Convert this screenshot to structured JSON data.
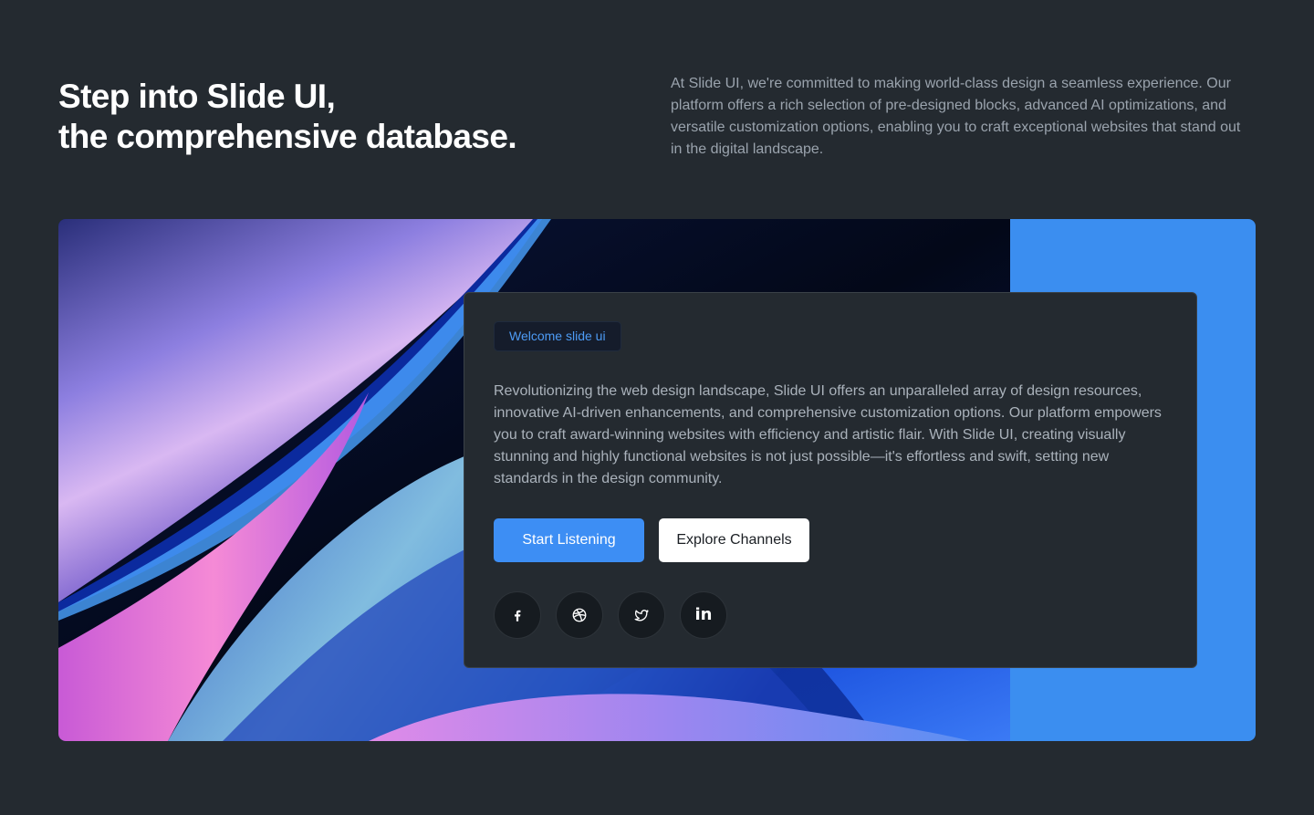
{
  "hero": {
    "title_line1": "Step into Slide UI,",
    "title_line2": "the comprehensive database.",
    "description": "At Slide UI, we're committed to making world-class design a seamless experience. Our platform offers a rich selection of pre-designed blocks, advanced AI optimizations, and versatile customization options, enabling you to craft exceptional websites that stand out in the digital landscape."
  },
  "card": {
    "badge": "Welcome slide ui",
    "text": "Revolutionizing the web design landscape, Slide UI offers an unparalleled array of design resources, innovative AI-driven enhancements, and comprehensive customization options. Our platform empowers you to craft award-winning websites with efficiency and artistic flair. With Slide UI, creating visually stunning and highly functional websites is not just possible—it's effortless and swift, setting new standards in the design community.",
    "primary_button": "Start Listening",
    "secondary_button": "Explore Channels",
    "linkedin_glyph": "in"
  },
  "colors": {
    "background": "#242a30",
    "accent_blue": "#3d8ef4",
    "panel_blue": "#3b8ef0",
    "badge_text": "#4d9bf5"
  },
  "social_icons": [
    "facebook-icon",
    "dribbble-icon",
    "twitter-icon",
    "linkedin-icon"
  ]
}
